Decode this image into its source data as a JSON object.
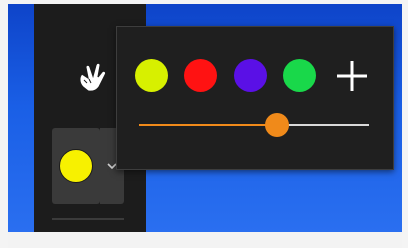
{
  "toolbar": {
    "current_color": "#f7f100",
    "icons": {
      "hand": "hand-pointer-icon",
      "dropdown": "chevron-down-icon"
    }
  },
  "color_flyout": {
    "swatches": [
      {
        "name": "yellow-green",
        "color": "#d7f000"
      },
      {
        "name": "red",
        "color": "#ff1212"
      },
      {
        "name": "purple",
        "color": "#5a10e6"
      },
      {
        "name": "green",
        "color": "#19d84a"
      }
    ],
    "add_icon": "plus-icon",
    "size_slider": {
      "value_fraction": 0.6,
      "track_color": "#d9d9d9",
      "accent_color": "#f08a1a"
    }
  }
}
